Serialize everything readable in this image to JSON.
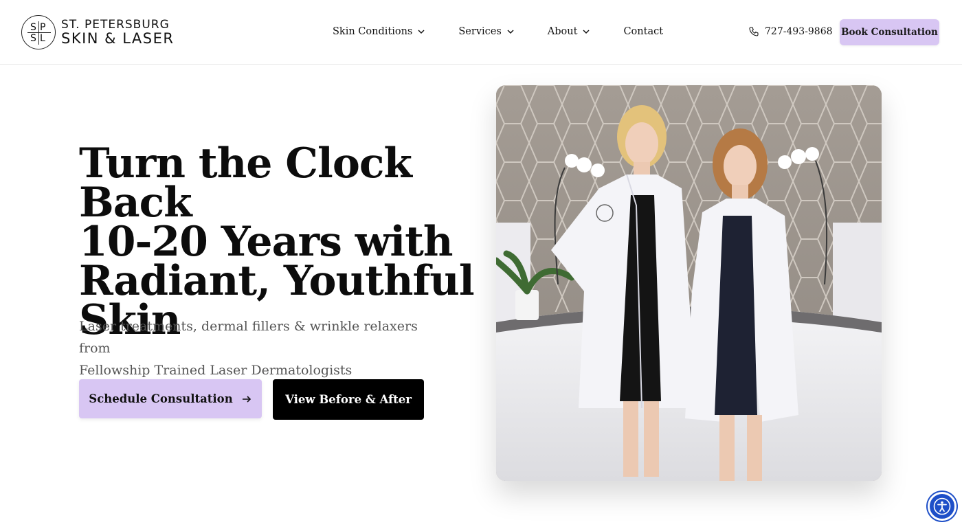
{
  "brand": {
    "monogram": [
      "S",
      "P",
      "S",
      "L"
    ],
    "line1": "ST. PETERSBURG",
    "line2": "SKIN & LASER"
  },
  "nav": {
    "items": [
      {
        "label": "Skin Conditions",
        "has_dropdown": true
      },
      {
        "label": "Services",
        "has_dropdown": true
      },
      {
        "label": "About",
        "has_dropdown": true
      },
      {
        "label": "Contact",
        "has_dropdown": false
      }
    ]
  },
  "header": {
    "phone": "727-493-9868",
    "phone_icon": "phone-icon",
    "book_label": "Book Consultation"
  },
  "hero": {
    "headline_lines": [
      "Turn the Clock Back",
      "10-20 Years with",
      "Radiant, Youthful",
      "Skin"
    ],
    "subheadline_lines": [
      "Laser treatments, dermal fillers & wrinkle relaxers from",
      "Fellowship Trained Laser Dermatologists"
    ],
    "primary_cta": "Schedule Consultation",
    "secondary_cta": "View Before & After",
    "photo_icon": "doctors-photo"
  },
  "colors": {
    "accent": "#d8c6f3",
    "dark_button": "#000000",
    "accessibility_blue": "#1e4fc8"
  },
  "widgets": {
    "accessibility_icon": "accessibility-icon"
  }
}
